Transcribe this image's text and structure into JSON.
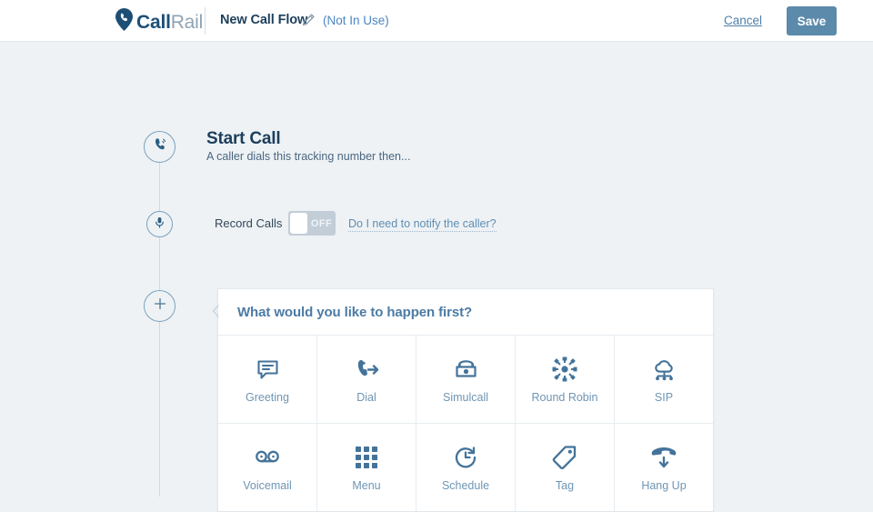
{
  "header": {
    "logo_call": "Call",
    "logo_rail": "Rail",
    "logo_icon": "map-pin-phone-icon",
    "flow_name": "New Call Flow",
    "edit_icon": "pencil-icon",
    "status": "(Not In Use)",
    "cancel_label": "Cancel",
    "save_label": "Save",
    "accent_color": "#5b8aab",
    "link_color": "#4a86c4"
  },
  "flow": {
    "start": {
      "icon": "phone-ringing-icon",
      "title": "Start Call",
      "subtitle": "A caller dials this tracking number then..."
    },
    "record": {
      "icon": "microphone-icon",
      "label": "Record Calls",
      "toggle_state": "OFF",
      "help_link": "Do I need to notify the caller?"
    },
    "add": {
      "icon": "plus-icon"
    }
  },
  "action_card": {
    "heading": "What would you like to happen first?",
    "caret_icon": "chevron-left-icon",
    "rows": [
      [
        {
          "icon": "speech-bubble-icon",
          "label": "Greeting"
        },
        {
          "icon": "phone-forward-icon",
          "label": "Dial"
        },
        {
          "icon": "desk-phone-icon",
          "label": "Simulcall"
        },
        {
          "icon": "hub-spokes-icon",
          "label": "Round Robin"
        },
        {
          "icon": "cloud-network-icon",
          "label": "SIP"
        }
      ],
      [
        {
          "icon": "cassette-tape-icon",
          "label": "Voicemail"
        },
        {
          "icon": "keypad-grid-icon",
          "label": "Menu"
        },
        {
          "icon": "clock-refresh-icon",
          "label": "Schedule"
        },
        {
          "icon": "price-tag-icon",
          "label": "Tag"
        },
        {
          "icon": "handset-down-icon",
          "label": "Hang Up"
        }
      ]
    ]
  }
}
